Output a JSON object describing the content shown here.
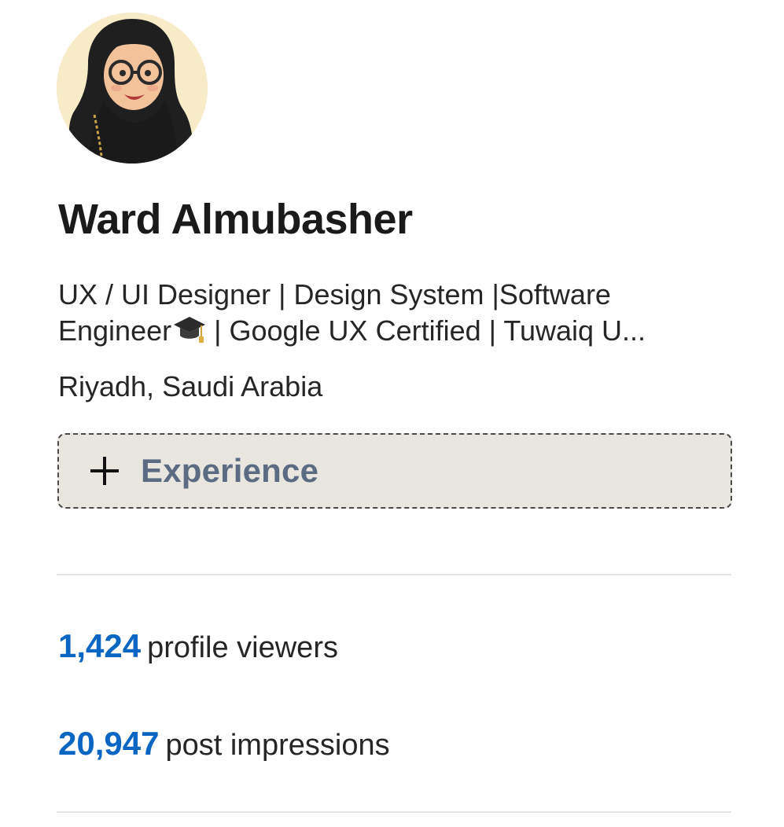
{
  "profile": {
    "name": "Ward Almubasher",
    "headline_line1": "UX / UI Designer | Design System |Software",
    "headline_line2_a": "Engineer",
    "headline_line2_b": " | Google UX Certified | Tuwaiq U...",
    "location": "Riyadh, Saudi Arabia",
    "avatar_icon": "avatar-illustration",
    "cap_icon": "graduation-cap-icon"
  },
  "experience_button": {
    "label": "Experience",
    "icon": "plus-icon"
  },
  "stats": {
    "viewers_count": "1,424",
    "viewers_label": "profile viewers",
    "impressions_count": "20,947",
    "impressions_label": "post impressions"
  },
  "colors": {
    "accent_blue": "#0a66c2",
    "button_bg": "#e9e6e0",
    "button_text": "#5b6b82",
    "avatar_bg": "#f7ebc8"
  }
}
